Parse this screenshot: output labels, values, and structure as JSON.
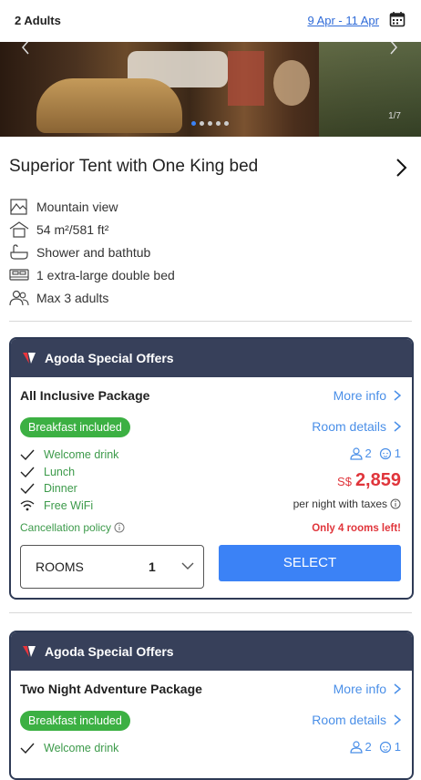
{
  "header": {
    "guests": "2 Adults",
    "dates": "9 Apr - 11 Apr",
    "calendar_icon": "calendar-icon"
  },
  "gallery": {
    "counter": "1/7",
    "dots_count": 5,
    "active_dot": 0
  },
  "room": {
    "title": "Superior Tent with One King bed",
    "features": [
      {
        "icon": "mountain-view-icon",
        "label": "Mountain view"
      },
      {
        "icon": "house-size-icon",
        "label": "54 m²/581 ft²"
      },
      {
        "icon": "bathtub-icon",
        "label": "Shower and bathtub"
      },
      {
        "icon": "bed-icon",
        "label": "1 extra-large double bed"
      },
      {
        "icon": "people-icon",
        "label": "Max 3 adults"
      }
    ]
  },
  "offers": [
    {
      "header": "Agoda Special Offers",
      "package": "All Inclusive Package",
      "more_info": "More info",
      "room_details": "Room details",
      "badge": "Breakfast included",
      "inclusions": [
        {
          "icon": "check-icon",
          "label": "Welcome drink"
        },
        {
          "icon": "check-icon",
          "label": "Lunch"
        },
        {
          "icon": "check-icon",
          "label": "Dinner"
        },
        {
          "icon": "wifi-icon",
          "label": "Free WiFi"
        }
      ],
      "adults": "2",
      "children": "1",
      "currency": "S$",
      "price": "2,859",
      "per_night": "per night with taxes",
      "cancellation": "Cancellation policy",
      "rooms_left": "Only 4 rooms left!",
      "rooms_label": "ROOMS",
      "rooms_value": "1",
      "select_label": "SELECT"
    },
    {
      "header": "Agoda Special Offers",
      "package": "Two Night Adventure Package",
      "more_info": "More info",
      "room_details": "Room details",
      "badge": "Breakfast included",
      "inclusions": [
        {
          "icon": "check-icon",
          "label": "Welcome drink"
        }
      ],
      "adults": "2",
      "children": "1"
    }
  ],
  "colors": {
    "accent_blue": "#3b82f6",
    "link_blue": "#4a8fe8",
    "offer_header": "#37405a",
    "green": "#3cb043",
    "price_red": "#e0353b"
  }
}
